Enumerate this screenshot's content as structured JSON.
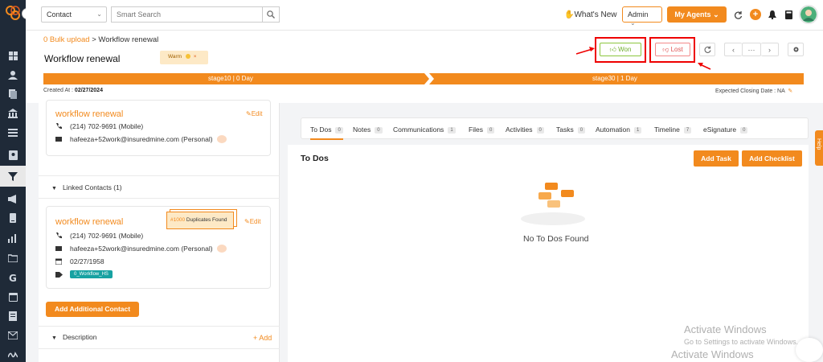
{
  "header": {
    "contact_select": "Contact",
    "search_placeholder": "Smart Search",
    "whats_new": "What's New",
    "role_select": "Admin",
    "my_agents": "My Agents"
  },
  "breadcrumb": {
    "parent": "0 Bulk upload",
    "separator": ">",
    "current": "Workflow renewal"
  },
  "page": {
    "title": "Workflow renewal",
    "tag_label": "Warm",
    "won_label": "Won",
    "lost_label": "Lost"
  },
  "stages": [
    {
      "label": "stage10 | 0 Day"
    },
    {
      "label": "stage30 | 1 Day"
    }
  ],
  "meta": {
    "created_label": "Created At :",
    "created_value": "02/27/2024",
    "closing_label": "Expected Closing Date : NA"
  },
  "primary_contact": {
    "name": "workflow renewal",
    "edit": "Edit",
    "phone": "(214) 702-9691 (Mobile)",
    "email": "hafeeza+52work@insuredmine.com (Personal)"
  },
  "linked_contacts": {
    "heading": "Linked Contacts (1)",
    "contact": {
      "name": "workflow renewal",
      "duplicates_count": "#1000",
      "duplicates_label": "Duplicates Found",
      "edit": "Edit",
      "phone": "(214) 702-9691 (Mobile)",
      "email": "hafeeza+52work@insuredmine.com (Personal)",
      "dob": "02/27/1958",
      "tag": "0_Workflow_HS"
    },
    "add_button": "Add Additional Contact"
  },
  "description": {
    "heading": "Description",
    "add": "+ Add"
  },
  "tabs": [
    {
      "label": "To Dos",
      "count": "0"
    },
    {
      "label": "Notes",
      "count": "0"
    },
    {
      "label": "Communications",
      "count": "1"
    },
    {
      "label": "Files",
      "count": "0"
    },
    {
      "label": "Activities",
      "count": "0"
    },
    {
      "label": "Tasks",
      "count": "0"
    },
    {
      "label": "Automation",
      "count": "1"
    },
    {
      "label": "Timeline",
      "count": "7"
    },
    {
      "label": "eSignature",
      "count": "0"
    }
  ],
  "todos": {
    "title": "To Dos",
    "add_task": "Add Task",
    "add_checklist": "Add Checklist",
    "empty": "No To Dos Found"
  },
  "help_label": "Help",
  "watermark": {
    "line1": "Activate Windows",
    "line2": "Go to Settings to activate Windows.",
    "line3": "Activate Windows"
  },
  "colors": {
    "accent": "#f28a1e",
    "sidebar": "#1f2a38",
    "won": "#6fae2c",
    "lost": "#e05555",
    "highlight": "#ee0000",
    "tag": "#17a2a2"
  }
}
